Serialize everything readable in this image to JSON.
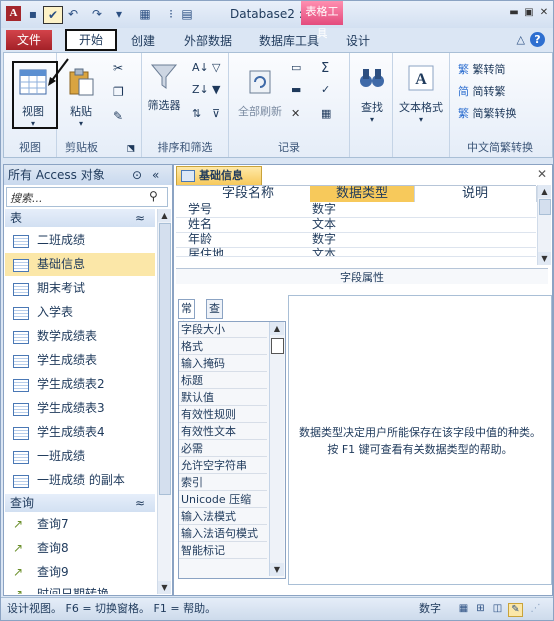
{
  "title_bar": {
    "title": "Database2 : ...",
    "context_tab": "表格工具"
  },
  "tabs": [
    {
      "label": "文件"
    },
    {
      "label": "开始"
    },
    {
      "label": "创建"
    },
    {
      "label": "外部数据"
    },
    {
      "label": "数据库工具"
    },
    {
      "label": "设计"
    }
  ],
  "ribbon": {
    "view_label": "视图",
    "paste_label": "粘贴",
    "filter_label": "筛选器",
    "delete_all_label": "全部刷新",
    "find_label": "查找",
    "text_format_label": "文本格式",
    "trad_to_simp": "繁转简",
    "simp_to_trad": "简转繁",
    "simp_trad_convert": "简繁转换",
    "groups": {
      "view": "视图",
      "clipboard": "剪贴板",
      "sort_filter": "排序和筛选",
      "records": "记录",
      "chinese": "中文简繁转换"
    }
  },
  "nav": {
    "header": "所有 Access 对象",
    "search_placeholder": "搜索...",
    "section_tables": "表",
    "tables": [
      "二班成绩",
      "基础信息",
      "期末考试",
      "入学表",
      "数学成绩表",
      "学生成绩表",
      "学生成绩表2",
      "学生成绩表3",
      "学生成绩表4",
      "一班成绩",
      "一班成绩 的副本"
    ],
    "selected_table": "基础信息",
    "section_queries": "查询",
    "queries": [
      "查询7",
      "查询8",
      "查询9",
      "时间日期转换"
    ]
  },
  "document": {
    "tab_label": "基础信息",
    "columns": [
      "字段名称",
      "数据类型",
      "说明"
    ],
    "rows": [
      {
        "name": "学号",
        "type": "数字"
      },
      {
        "name": "姓名",
        "type": "文本"
      },
      {
        "name": "年龄",
        "type": "数字"
      },
      {
        "name": "居住地",
        "type": "文本"
      }
    ],
    "props_title": "字段属性",
    "props_tabs": [
      "常规",
      "查阅"
    ],
    "props_items": [
      "字段大小",
      "格式",
      "输入掩码",
      "标题",
      "默认值",
      "有效性规则",
      "有效性文本",
      "必需",
      "允许空字符串",
      "索引",
      "Unicode 压缩",
      "输入法模式",
      "输入法语句模式",
      "智能标记"
    ],
    "help_text": "数据类型决定用户所能保存在该字段中值的种类。按 F1 键可查看有关数据类型的帮助。"
  },
  "status": {
    "left": "设计视图。 F6 = 切换窗格。 F1 = 帮助。",
    "right": "数字"
  },
  "colors": {
    "file_tab": "#a32128",
    "context_tab": "#e34b7d",
    "selected_row": "#fbe7a8",
    "type_header": "#f7c95b"
  }
}
